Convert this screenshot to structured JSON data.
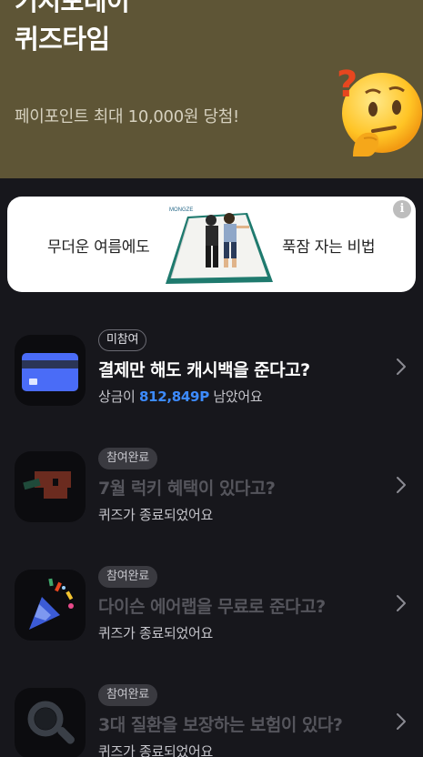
{
  "hero": {
    "title_top": "기지포네이",
    "title": "퀴즈타임",
    "subtitle": "페이포인트 최대 10,000원 당첨!",
    "emoji": "thinking-face-icon"
  },
  "banner": {
    "left_text": "무더운 여름에도",
    "right_text": "푹잠 자는 비법",
    "brand": "MONGZE",
    "info": "i"
  },
  "quizzes": [
    {
      "badge": "미참여",
      "title": "결제만 해도 캐시백을 준다고?",
      "sub_prefix": "상금이 ",
      "prize": "812,849P",
      "sub_suffix": " 남았어요",
      "icon": "credit-card-icon"
    },
    {
      "badge": "참여완료",
      "title": "7월 럭키 혜택이 있다고?",
      "sub": "퀴즈가 종료되었어요",
      "icon": "coupon-icon"
    },
    {
      "badge": "참여완료",
      "title": "다이슨 에어랩을 무료로 준다고?",
      "sub": "퀴즈가 종료되었어요",
      "icon": "party-popper-icon"
    },
    {
      "badge": "참여완료",
      "title": "3대 질환을 보장하는 보험이 있다?",
      "sub": "퀴즈가 종료되었어요",
      "icon": "magnifier-icon"
    }
  ],
  "colors": {
    "background": "#17171c",
    "hero": "#5e5536",
    "prize": "#3d8bff"
  }
}
